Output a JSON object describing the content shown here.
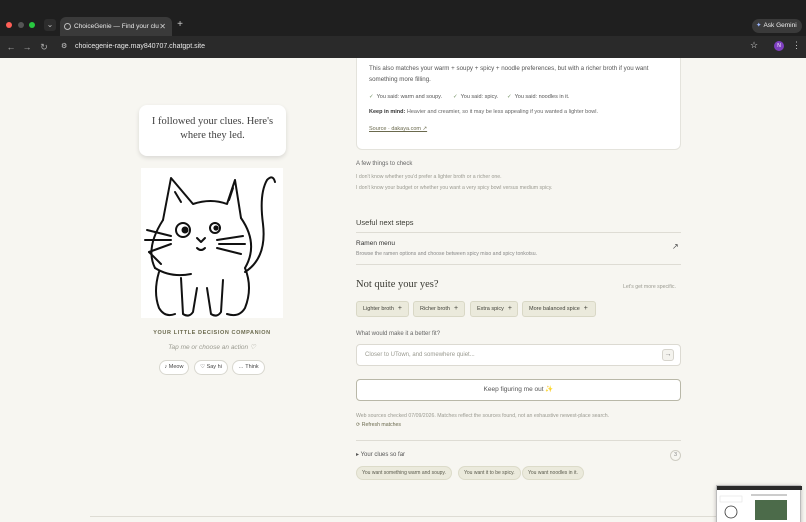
{
  "browser": {
    "tab_title": "ChoiceGenie — Find your clu",
    "url": "choicegenie-rage.may840707.chatgpt.site",
    "ask_gemini": "Ask Gemini",
    "profile_initial": "N"
  },
  "left": {
    "bubble_text": "I followed your clues. Here's where they led.",
    "companion_label": "YOUR LITTLE DECISION COMPANION",
    "tap_hint": "Tap me or choose an action ♡",
    "actions": [
      "♪ Meow",
      "♡ Say hi",
      "… Think"
    ]
  },
  "result_card": {
    "body": "This also matches your warm + soupy + spicy + noodle preferences, but with a richer broth if you want something more filling.",
    "checks": [
      "You said: warm and soupy.",
      "You said: spicy.",
      "You said: noodles in it."
    ],
    "keep_label": "Keep in mind:",
    "keep_text": "Heavier and creamier, so it may be less appealing if you wanted a lighter bowl.",
    "source": "Source · dakaya.com ↗"
  },
  "check_things": {
    "heading": "A few things to check",
    "items": [
      "I don't know whether you'd prefer a lighter broth or a richer one.",
      "I don't know your budget or whether you want a very spicy bowl versus medium spicy."
    ]
  },
  "next_steps": {
    "heading": "Useful next steps",
    "title": "Ramen menu",
    "subtitle": "Browse the ramen options and choose between spicy miso and spicy tonkotsu.",
    "arrow": "↗"
  },
  "refine": {
    "heading": "Not quite your yes?",
    "hint": "Let's get more specific.",
    "chips": [
      "Lighter broth",
      "Richer broth",
      "Extra spicy",
      "More balanced spice"
    ],
    "question": "What would make it a better fit?",
    "placeholder": "Closer to UTown, and somewhere quiet...",
    "send": "→",
    "button": "Keep figuring me out ✨"
  },
  "sources": {
    "note": "Web sources checked 07/09/2026. Matches reflect the sources found, not an exhaustive newest-place search.",
    "refresh": "⟳ Refresh matches"
  },
  "clues": {
    "heading": "▸ Your clues so far",
    "count": "3",
    "items": [
      "You want something warm and soupy.",
      "You want it to be spicy.",
      "You want noodles in it."
    ]
  }
}
